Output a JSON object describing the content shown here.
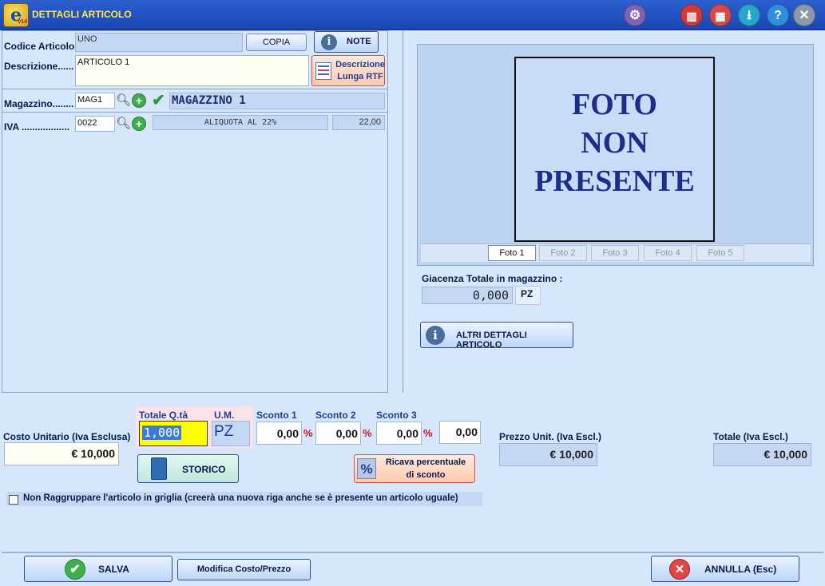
{
  "window": {
    "title": "DETTAGLI ARTICOLO",
    "logo_letter": "e",
    "logo_badge": "v14"
  },
  "toolbar_icons": [
    {
      "name": "settings-gear-icon",
      "glyph": "⚙",
      "color": "#7d62b6"
    },
    {
      "name": "library-icon",
      "glyph": "▥",
      "color": "#d23a3a"
    },
    {
      "name": "calculator-icon",
      "glyph": "▦",
      "color": "#d74848"
    },
    {
      "name": "download-icon",
      "glyph": "⭳",
      "color": "#26a7c9"
    },
    {
      "name": "help-icon",
      "glyph": "?",
      "color": "#2f8fdd"
    },
    {
      "name": "close-icon",
      "glyph": "✕",
      "color": "#8c99ab"
    }
  ],
  "form": {
    "codice_label": "Codice Articolo.",
    "codice_value": "UNO",
    "copia_label": "COPIA",
    "note_label": "NOTE",
    "descrizione_label": "Descrizione......",
    "descrizione_value": "ARTICOLO 1",
    "desc_lunga_label_1": "Descrizione",
    "desc_lunga_label_2": "Lunga RTF",
    "magazzino_label": "Magazzino........",
    "magazzino_code": "MAG1",
    "magazzino_name": "MAGAZZINO 1",
    "iva_label": "IVA ..................",
    "iva_code": "0022",
    "iva_desc": "ALIQUOTA AL 22%",
    "iva_rate": "22,00"
  },
  "photo": {
    "placeholder_line1": "FOTO",
    "placeholder_line2": "NON",
    "placeholder_line3": "PRESENTE",
    "tabs": [
      "Foto 1",
      "Foto 2",
      "Foto 3",
      "Foto 4",
      "Foto 5"
    ],
    "active_tab": 0
  },
  "stock": {
    "label": "Giacenza Totale in magazzino :",
    "value": "0,000",
    "unit": "PZ",
    "altri_dettagli_label": "ALTRI DETTAGLI ARTICOLO"
  },
  "pricing": {
    "costo_label": "Costo Unitario (Iva Esclusa)",
    "costo_value": "€ 10,000",
    "qta_label": "Totale Q.tà",
    "qta_value": "1,000",
    "um_label": "U.M.",
    "um_value": "PZ",
    "sconto1_label": "Sconto 1",
    "sconto1_value": "0,00",
    "sconto2_label": "Sconto 2",
    "sconto2_value": "0,00",
    "sconto3_label": "Sconto 3",
    "sconto3_value": "0,00",
    "sconto_extra_value": "0,00",
    "percent": "%",
    "storico_label": "STORICO",
    "ricava_label_1": "Ricava percentuale",
    "ricava_label_2": "di sconto",
    "prezzo_label": "Prezzo Unit. (Iva Escl.)",
    "prezzo_value": "€ 10,000",
    "totale_label": "Totale (Iva Escl.)",
    "totale_value": "€ 10,000"
  },
  "options": {
    "non_raggruppare_label": "Non Raggruppare l'articolo in griglia (creerà una nuova riga anche se è presente un articolo uguale)",
    "non_raggruppare_checked": false
  },
  "footer": {
    "salva_label": "SALVA",
    "modifica_label": "Modifica Costo/Prezzo",
    "annulla_label": "ANNULLA (Esc)"
  }
}
